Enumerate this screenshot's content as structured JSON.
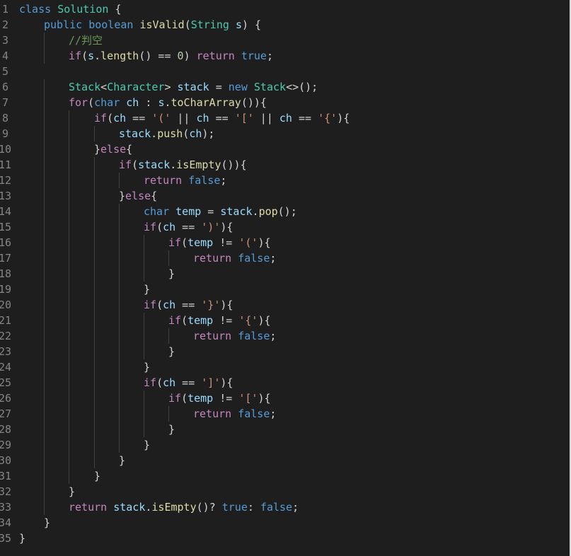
{
  "colors": {
    "background": "#1e1e1e",
    "line_number": "#858585",
    "indent_guide": "#404040",
    "keyword": "#569cd6",
    "control": "#c586c0",
    "type": "#4ec9b0",
    "function": "#dcdcaa",
    "variable": "#9cdcfe",
    "string": "#ce9178",
    "number": "#b5cea8",
    "comment": "#6a9955",
    "punctuation": "#d4d4d4"
  },
  "lines": [
    {
      "n": "1",
      "indent": 0,
      "tokens": [
        [
          "kw",
          "class"
        ],
        [
          "punc",
          " "
        ],
        [
          "type",
          "Solution"
        ],
        [
          "punc",
          " {"
        ]
      ]
    },
    {
      "n": "2",
      "indent": 1,
      "tokens": [
        [
          "kw",
          "public"
        ],
        [
          "punc",
          " "
        ],
        [
          "kw",
          "boolean"
        ],
        [
          "punc",
          " "
        ],
        [
          "fn",
          "isValid"
        ],
        [
          "punc",
          "("
        ],
        [
          "type",
          "String"
        ],
        [
          "punc",
          " "
        ],
        [
          "var",
          "s"
        ],
        [
          "punc",
          ") {"
        ]
      ]
    },
    {
      "n": "3",
      "indent": 2,
      "tokens": [
        [
          "cmt",
          "//判空"
        ]
      ]
    },
    {
      "n": "4",
      "indent": 2,
      "tokens": [
        [
          "ctrl",
          "if"
        ],
        [
          "punc",
          "("
        ],
        [
          "var",
          "s"
        ],
        [
          "punc",
          "."
        ],
        [
          "fn",
          "length"
        ],
        [
          "punc",
          "() == "
        ],
        [
          "num",
          "0"
        ],
        [
          "punc",
          ") "
        ],
        [
          "ctrl",
          "return"
        ],
        [
          "punc",
          " "
        ],
        [
          "kw",
          "true"
        ],
        [
          "punc",
          ";"
        ]
      ]
    },
    {
      "n": "5",
      "indent": 0,
      "tokens": []
    },
    {
      "n": "6",
      "indent": 2,
      "tokens": [
        [
          "type",
          "Stack"
        ],
        [
          "punc",
          "<"
        ],
        [
          "type",
          "Character"
        ],
        [
          "punc",
          "> "
        ],
        [
          "var",
          "stack"
        ],
        [
          "punc",
          " = "
        ],
        [
          "kw",
          "new"
        ],
        [
          "punc",
          " "
        ],
        [
          "type",
          "Stack"
        ],
        [
          "punc",
          "<>();"
        ]
      ]
    },
    {
      "n": "7",
      "indent": 2,
      "tokens": [
        [
          "ctrl",
          "for"
        ],
        [
          "punc",
          "("
        ],
        [
          "kw",
          "char"
        ],
        [
          "punc",
          " "
        ],
        [
          "var",
          "ch"
        ],
        [
          "punc",
          " : "
        ],
        [
          "var",
          "s"
        ],
        [
          "punc",
          "."
        ],
        [
          "fn",
          "toCharArray"
        ],
        [
          "punc",
          "()){"
        ]
      ]
    },
    {
      "n": "8",
      "indent": 3,
      "tokens": [
        [
          "ctrl",
          "if"
        ],
        [
          "punc",
          "("
        ],
        [
          "var",
          "ch"
        ],
        [
          "punc",
          " == "
        ],
        [
          "str",
          "'('"
        ],
        [
          "punc",
          " || "
        ],
        [
          "var",
          "ch"
        ],
        [
          "punc",
          " == "
        ],
        [
          "str",
          "'['"
        ],
        [
          "punc",
          " || "
        ],
        [
          "var",
          "ch"
        ],
        [
          "punc",
          " == "
        ],
        [
          "str",
          "'{'"
        ],
        [
          "punc",
          "){"
        ]
      ]
    },
    {
      "n": "9",
      "indent": 4,
      "tokens": [
        [
          "var",
          "stack"
        ],
        [
          "punc",
          "."
        ],
        [
          "fn",
          "push"
        ],
        [
          "punc",
          "("
        ],
        [
          "var",
          "ch"
        ],
        [
          "punc",
          ");"
        ]
      ]
    },
    {
      "n": "10",
      "indent": 3,
      "tokens": [
        [
          "punc",
          "}"
        ],
        [
          "ctrl",
          "else"
        ],
        [
          "punc",
          "{"
        ]
      ]
    },
    {
      "n": "11",
      "indent": 4,
      "tokens": [
        [
          "ctrl",
          "if"
        ],
        [
          "punc",
          "("
        ],
        [
          "var",
          "stack"
        ],
        [
          "punc",
          "."
        ],
        [
          "fn",
          "isEmpty"
        ],
        [
          "punc",
          "()){"
        ]
      ]
    },
    {
      "n": "12",
      "indent": 5,
      "tokens": [
        [
          "ctrl",
          "return"
        ],
        [
          "punc",
          " "
        ],
        [
          "kw",
          "false"
        ],
        [
          "punc",
          ";"
        ]
      ]
    },
    {
      "n": "13",
      "indent": 4,
      "tokens": [
        [
          "punc",
          "}"
        ],
        [
          "ctrl",
          "else"
        ],
        [
          "punc",
          "{"
        ]
      ]
    },
    {
      "n": "14",
      "indent": 5,
      "tokens": [
        [
          "kw",
          "char"
        ],
        [
          "punc",
          " "
        ],
        [
          "var",
          "temp"
        ],
        [
          "punc",
          " = "
        ],
        [
          "var",
          "stack"
        ],
        [
          "punc",
          "."
        ],
        [
          "fn",
          "pop"
        ],
        [
          "punc",
          "();"
        ]
      ]
    },
    {
      "n": "15",
      "indent": 5,
      "tokens": [
        [
          "ctrl",
          "if"
        ],
        [
          "punc",
          "("
        ],
        [
          "var",
          "ch"
        ],
        [
          "punc",
          " == "
        ],
        [
          "str",
          "')'"
        ],
        [
          "punc",
          "){"
        ]
      ]
    },
    {
      "n": "16",
      "indent": 6,
      "tokens": [
        [
          "ctrl",
          "if"
        ],
        [
          "punc",
          "("
        ],
        [
          "var",
          "temp"
        ],
        [
          "punc",
          " != "
        ],
        [
          "str",
          "'('"
        ],
        [
          "punc",
          "){"
        ]
      ]
    },
    {
      "n": "17",
      "indent": 7,
      "tokens": [
        [
          "ctrl",
          "return"
        ],
        [
          "punc",
          " "
        ],
        [
          "kw",
          "false"
        ],
        [
          "punc",
          ";"
        ]
      ]
    },
    {
      "n": "18",
      "indent": 6,
      "tokens": [
        [
          "punc",
          "}"
        ]
      ]
    },
    {
      "n": "19",
      "indent": 5,
      "tokens": [
        [
          "punc",
          "}"
        ]
      ]
    },
    {
      "n": "20",
      "indent": 5,
      "tokens": [
        [
          "ctrl",
          "if"
        ],
        [
          "punc",
          "("
        ],
        [
          "var",
          "ch"
        ],
        [
          "punc",
          " == "
        ],
        [
          "str",
          "'}'"
        ],
        [
          "punc",
          "){"
        ]
      ]
    },
    {
      "n": "21",
      "indent": 6,
      "tokens": [
        [
          "ctrl",
          "if"
        ],
        [
          "punc",
          "("
        ],
        [
          "var",
          "temp"
        ],
        [
          "punc",
          " != "
        ],
        [
          "str",
          "'{'"
        ],
        [
          "punc",
          "){"
        ]
      ]
    },
    {
      "n": "22",
      "indent": 7,
      "tokens": [
        [
          "ctrl",
          "return"
        ],
        [
          "punc",
          " "
        ],
        [
          "kw",
          "false"
        ],
        [
          "punc",
          ";"
        ]
      ]
    },
    {
      "n": "23",
      "indent": 6,
      "tokens": [
        [
          "punc",
          "}"
        ]
      ]
    },
    {
      "n": "24",
      "indent": 5,
      "tokens": [
        [
          "punc",
          "}"
        ]
      ]
    },
    {
      "n": "25",
      "indent": 5,
      "tokens": [
        [
          "ctrl",
          "if"
        ],
        [
          "punc",
          "("
        ],
        [
          "var",
          "ch"
        ],
        [
          "punc",
          " == "
        ],
        [
          "str",
          "']'"
        ],
        [
          "punc",
          "){"
        ]
      ]
    },
    {
      "n": "26",
      "indent": 6,
      "tokens": [
        [
          "ctrl",
          "if"
        ],
        [
          "punc",
          "("
        ],
        [
          "var",
          "temp"
        ],
        [
          "punc",
          " != "
        ],
        [
          "str",
          "'['"
        ],
        [
          "punc",
          "){"
        ]
      ]
    },
    {
      "n": "27",
      "indent": 7,
      "tokens": [
        [
          "ctrl",
          "return"
        ],
        [
          "punc",
          " "
        ],
        [
          "kw",
          "false"
        ],
        [
          "punc",
          ";"
        ]
      ]
    },
    {
      "n": "28",
      "indent": 6,
      "tokens": [
        [
          "punc",
          "}"
        ]
      ]
    },
    {
      "n": "29",
      "indent": 5,
      "tokens": [
        [
          "punc",
          "}"
        ]
      ]
    },
    {
      "n": "30",
      "indent": 4,
      "tokens": [
        [
          "punc",
          "}"
        ]
      ]
    },
    {
      "n": "31",
      "indent": 3,
      "tokens": [
        [
          "punc",
          "}"
        ]
      ]
    },
    {
      "n": "32",
      "indent": 2,
      "tokens": [
        [
          "punc",
          "}"
        ]
      ]
    },
    {
      "n": "33",
      "indent": 2,
      "tokens": [
        [
          "ctrl",
          "return"
        ],
        [
          "punc",
          " "
        ],
        [
          "var",
          "stack"
        ],
        [
          "punc",
          "."
        ],
        [
          "fn",
          "isEmpty"
        ],
        [
          "punc",
          "()? "
        ],
        [
          "kw",
          "true"
        ],
        [
          "punc",
          ": "
        ],
        [
          "kw",
          "false"
        ],
        [
          "punc",
          ";"
        ]
      ]
    },
    {
      "n": "34",
      "indent": 1,
      "tokens": [
        [
          "punc",
          "}"
        ]
      ]
    },
    {
      "n": "35",
      "indent": 0,
      "tokens": [
        [
          "punc",
          "}"
        ]
      ]
    }
  ]
}
